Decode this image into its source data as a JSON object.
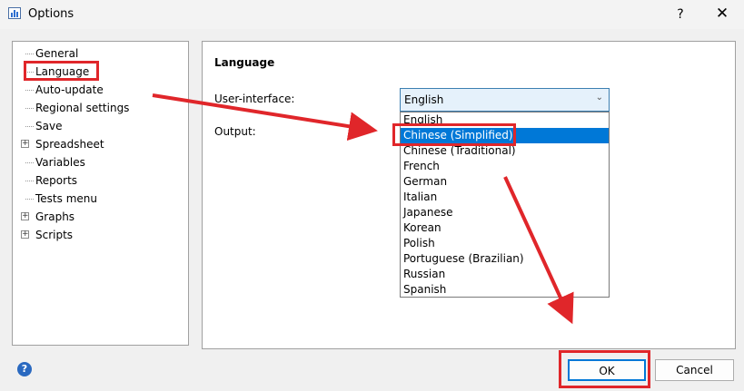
{
  "window": {
    "title": "Options",
    "help_glyph": "?",
    "close_glyph": "✕"
  },
  "tree": [
    {
      "label": "General",
      "expandable": false
    },
    {
      "label": "Language",
      "expandable": false
    },
    {
      "label": "Auto-update",
      "expandable": false
    },
    {
      "label": "Regional settings",
      "expandable": false
    },
    {
      "label": "Save",
      "expandable": false
    },
    {
      "label": "Spreadsheet",
      "expandable": true
    },
    {
      "label": "Variables",
      "expandable": false
    },
    {
      "label": "Reports",
      "expandable": false
    },
    {
      "label": "Tests menu",
      "expandable": false
    },
    {
      "label": "Graphs",
      "expandable": true
    },
    {
      "label": "Scripts",
      "expandable": true
    }
  ],
  "panel": {
    "section_title": "Language",
    "ui_label": "User-interface:",
    "output_label": "Output:",
    "ui_value": "English",
    "options": [
      "English",
      "Chinese (Simplified)",
      "Chinese (Traditional)",
      "French",
      "German",
      "Italian",
      "Japanese",
      "Korean",
      "Polish",
      "Portuguese (Brazilian)",
      "Russian",
      "Spanish"
    ],
    "highlighted_option": "Chinese (Simplified)"
  },
  "buttons": {
    "ok": "OK",
    "cancel": "Cancel",
    "help": "?"
  },
  "colors": {
    "annotation": "#e0262a",
    "selection": "#0078d7"
  }
}
